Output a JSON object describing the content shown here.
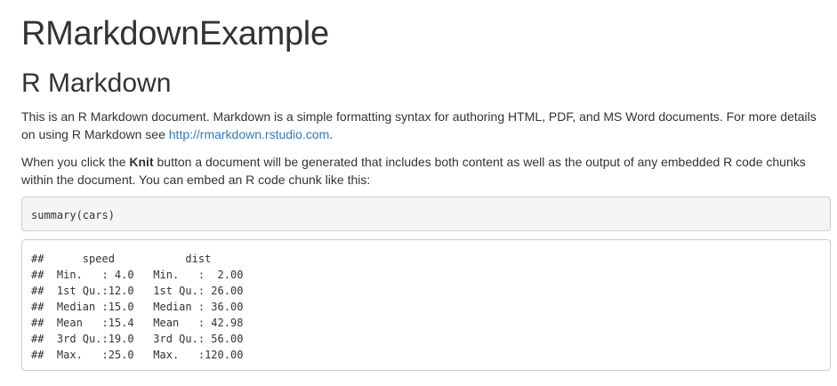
{
  "document": {
    "title": "RMarkdownExample",
    "section_heading": "R Markdown",
    "paragraph1": {
      "text_before_link": "This is an R Markdown document. Markdown is a simple formatting syntax for authoring HTML, PDF, and MS Word documents. For more details on using R Markdown see ",
      "link_text": "http://rmarkdown.rstudio.com",
      "text_after_link": "."
    },
    "paragraph2": {
      "text_before_bold": "When you click the ",
      "bold_text": "Knit",
      "text_after_bold": " button a document will be generated that includes both content as well as the output of any embedded R code chunks within the document. You can embed an R code chunk like this:"
    },
    "code_chunk": "summary(cars)",
    "output_lines": [
      "##      speed           dist       ",
      "##  Min.   : 4.0   Min.   :  2.00  ",
      "##  1st Qu.:12.0   1st Qu.: 26.00  ",
      "##  Median :15.0   Median : 36.00  ",
      "##  Mean   :15.4   Mean   : 42.98  ",
      "##  3rd Qu.:19.0   3rd Qu.: 56.00  ",
      "##  Max.   :25.0   Max.   :120.00  "
    ]
  }
}
